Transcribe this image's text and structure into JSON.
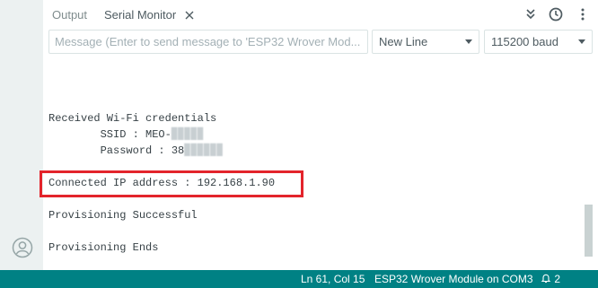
{
  "tabs": {
    "output_label": "Output",
    "serial_label": "Serial Monitor"
  },
  "input": {
    "placeholder": "Message (Enter to send message to 'ESP32 Wrover Mod...",
    "line_ending": "New Line",
    "baud_rate": "115200 baud"
  },
  "monitor": {
    "lines": [
      "Received Wi-Fi credentials",
      "        SSID : MEO-",
      "        Password : 38",
      "Connected IP address : 192.168.1.90",
      "Provisioning Successful",
      "Provisioning Ends"
    ],
    "ssid_masked": "▉▉▉▉▉",
    "password_masked": "▉▉▉▉▉▉"
  },
  "status": {
    "cursor_position": "Ln 61, Col 15",
    "board": "ESP32 Wrover Module on COM3",
    "notifications": "2"
  },
  "icons": {
    "autoscroll": "double-chevron-down-icon",
    "timestamp": "clock-icon",
    "more": "more-vertical-icon",
    "close": "close-icon",
    "account": "account-icon",
    "notifications": "bell-icon"
  },
  "colors": {
    "statusbar": "#008184",
    "highlight": "#e3242b"
  }
}
